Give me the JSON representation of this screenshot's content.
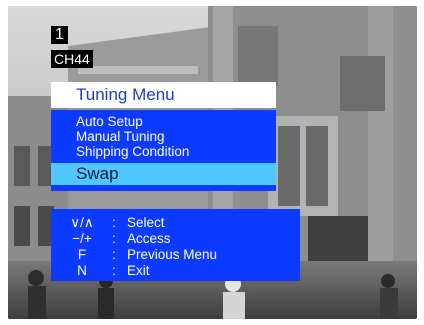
{
  "osd": {
    "channel_number": "1",
    "channel_name": "CH44"
  },
  "menu": {
    "title": "Tuning Menu",
    "items": [
      "Auto Setup",
      "Manual Tuning",
      "Shipping Condition"
    ],
    "selected_item": "Swap"
  },
  "help": {
    "rows": [
      {
        "key": "∨/∧",
        "colon": ":",
        "label": "Select"
      },
      {
        "key": "−/+",
        "colon": ":",
        "label": "Access"
      },
      {
        "key": "F",
        "colon": ":",
        "label": "Previous Menu"
      },
      {
        "key": "N",
        "colon": ":",
        "label": "Exit"
      }
    ]
  },
  "colors": {
    "menu_blue": "#0d3aff",
    "highlight": "#4ec8ff",
    "title_bg": "#ffffff"
  }
}
